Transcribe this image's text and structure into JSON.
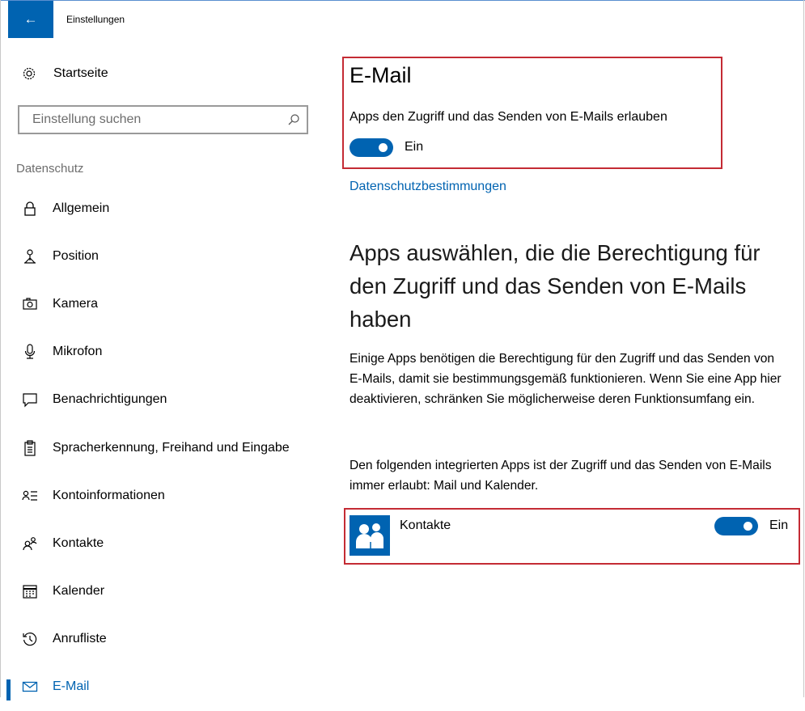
{
  "window": {
    "title": "Einstellungen",
    "back_icon": "arrow-left-icon",
    "accent": "#0063b1",
    "highlight": "#c42b34"
  },
  "sidebar": {
    "home_label": "Startseite",
    "search_placeholder": "Einstellung suchen",
    "section_title": "Datenschutz",
    "items": [
      {
        "label": "Allgemein",
        "icon": "lock-icon"
      },
      {
        "label": "Position",
        "icon": "location-icon"
      },
      {
        "label": "Kamera",
        "icon": "camera-icon"
      },
      {
        "label": "Mikrofon",
        "icon": "microphone-icon"
      },
      {
        "label": "Benachrichtigungen",
        "icon": "notification-icon"
      },
      {
        "label": "Spracherkennung, Freihand und Eingabe",
        "icon": "clipboard-icon"
      },
      {
        "label": "Kontoinformationen",
        "icon": "account-info-icon"
      },
      {
        "label": "Kontakte",
        "icon": "contacts-icon"
      },
      {
        "label": "Kalender",
        "icon": "calendar-icon"
      },
      {
        "label": "Anrufliste",
        "icon": "history-icon"
      },
      {
        "label": "E-Mail",
        "icon": "mail-icon",
        "active": true
      }
    ]
  },
  "main": {
    "title": "E-Mail",
    "permission_label": "Apps den Zugriff und das Senden von E-Mails erlauben",
    "permission_state": "Ein",
    "privacy_link": "Datenschutzbestimmungen",
    "apps_heading": "Apps auswählen, die die Berechtigung für den Zugriff und das Senden von E-Mails haben",
    "description": "Einige Apps benötigen die Berechtigung für den Zugriff und das Senden von E-Mails, damit sie bestimmungsgemäß funktionieren. Wenn Sie eine App hier deaktivieren, schränken Sie möglicherweise deren Funktionsumfang ein.",
    "builtin_note": "Den folgenden integrierten Apps ist der Zugriff und das Senden von E-Mails immer erlaubt: Mail und Kalender.",
    "apps": [
      {
        "name": "Kontakte",
        "state": "Ein",
        "icon": "people-icon"
      }
    ]
  }
}
